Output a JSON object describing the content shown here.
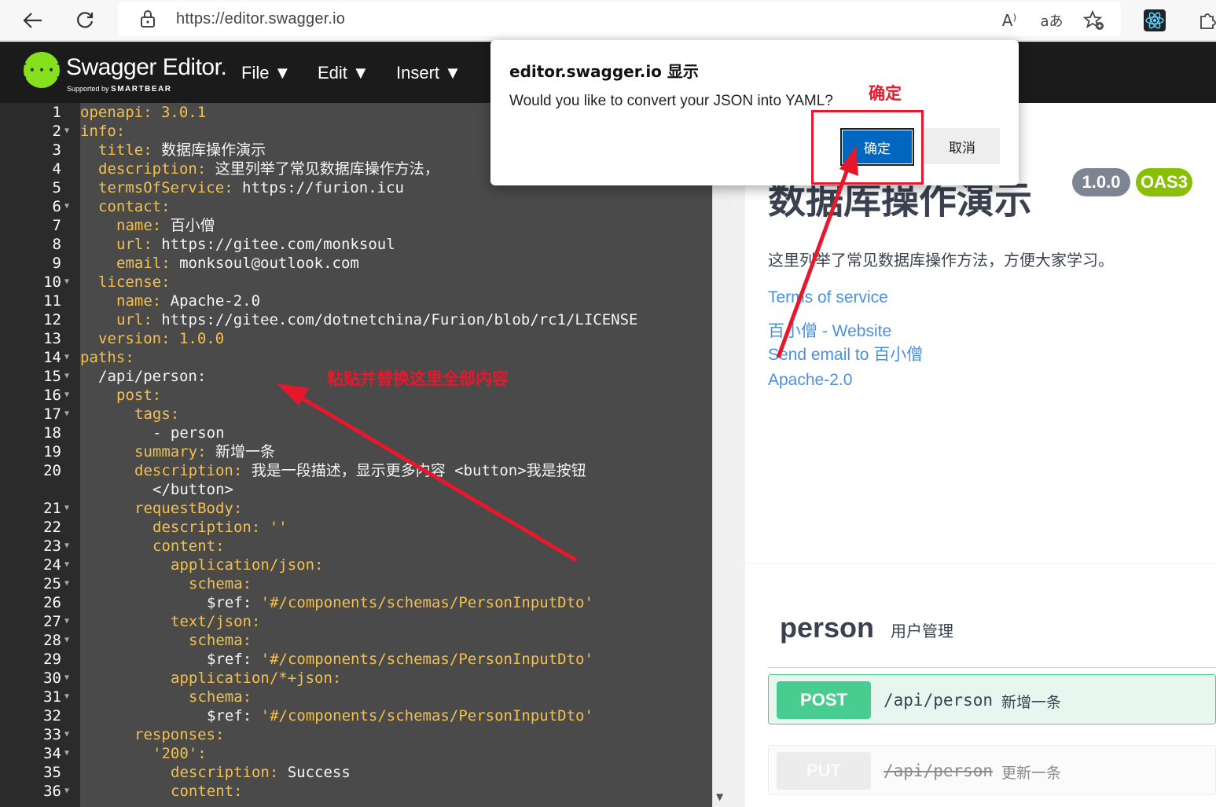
{
  "browser": {
    "url": "https://editor.swagger.io",
    "icons": [
      "back-arrow-icon",
      "refresh-icon",
      "lock-icon",
      "read-aloud-icon",
      "translate-icon",
      "favorite-add-icon",
      "react-devtools-icon",
      "extensions-icon"
    ],
    "read_aloud_glyph": "A⁾",
    "translate_glyph": "aあ"
  },
  "swagger": {
    "logo_glyph": "{···}",
    "title": "Swagger Editor.",
    "supported_prefix": "Supported by ",
    "supported_brand": "SMARTBEAR",
    "menu": [
      "File ▼",
      "Edit ▼",
      "Insert ▼"
    ]
  },
  "editor": {
    "lines": [
      {
        "n": "1",
        "fold": false,
        "indent": 0,
        "key": "openapi",
        "sep": ": ",
        "val": "3.0.1",
        "valtype": "s"
      },
      {
        "n": "2",
        "fold": true,
        "indent": 0,
        "key": "info",
        "sep": ":",
        "val": "",
        "valtype": "t"
      },
      {
        "n": "3",
        "fold": false,
        "indent": 1,
        "key": "title",
        "sep": ": ",
        "val": "数据库操作演示",
        "valtype": "t"
      },
      {
        "n": "4",
        "fold": false,
        "indent": 1,
        "key": "description",
        "sep": ": ",
        "val": "这里列举了常见数据库操作方法，",
        "valtype": "t"
      },
      {
        "n": "5",
        "fold": false,
        "indent": 1,
        "key": "termsOfService",
        "sep": ": ",
        "val": "https://furion.icu",
        "valtype": "t"
      },
      {
        "n": "6",
        "fold": true,
        "indent": 1,
        "key": "contact",
        "sep": ":",
        "val": "",
        "valtype": "t"
      },
      {
        "n": "7",
        "fold": false,
        "indent": 2,
        "key": "name",
        "sep": ": ",
        "val": "百小僧",
        "valtype": "t"
      },
      {
        "n": "8",
        "fold": false,
        "indent": 2,
        "key": "url",
        "sep": ": ",
        "val": "https://gitee.com/monksoul",
        "valtype": "t"
      },
      {
        "n": "9",
        "fold": false,
        "indent": 2,
        "key": "email",
        "sep": ": ",
        "val": "monksoul@outlook.com",
        "valtype": "t"
      },
      {
        "n": "10",
        "fold": true,
        "indent": 1,
        "key": "license",
        "sep": ":",
        "val": "",
        "valtype": "t"
      },
      {
        "n": "11",
        "fold": false,
        "indent": 2,
        "key": "name",
        "sep": ": ",
        "val": "Apache-2.0",
        "valtype": "t"
      },
      {
        "n": "12",
        "fold": false,
        "indent": 2,
        "key": "url",
        "sep": ": ",
        "val": "https://gitee.com/dotnetchina/Furion/blob/rc1/LICENSE",
        "valtype": "t"
      },
      {
        "n": "13",
        "fold": false,
        "indent": 1,
        "key": "version",
        "sep": ": ",
        "val": "1.0.0",
        "valtype": "s"
      },
      {
        "n": "14",
        "fold": true,
        "indent": 0,
        "key": "paths",
        "sep": ":",
        "val": "",
        "valtype": "t"
      },
      {
        "n": "15",
        "fold": true,
        "indent": 1,
        "key": "",
        "sep": "",
        "val": "/api/person:",
        "valtype": "t"
      },
      {
        "n": "16",
        "fold": true,
        "indent": 2,
        "key": "post",
        "sep": ":",
        "val": "",
        "valtype": "t"
      },
      {
        "n": "17",
        "fold": true,
        "indent": 3,
        "key": "tags",
        "sep": ":",
        "val": "",
        "valtype": "t"
      },
      {
        "n": "18",
        "fold": false,
        "indent": 4,
        "key": "",
        "sep": "",
        "val": "- person",
        "valtype": "t"
      },
      {
        "n": "19",
        "fold": false,
        "indent": 3,
        "key": "summary",
        "sep": ": ",
        "val": "新增一条",
        "valtype": "t"
      },
      {
        "n": "20",
        "fold": false,
        "indent": 3,
        "key": "description",
        "sep": ": ",
        "val": "我是一段描述，显示更多内容 <button>我是按钮",
        "valtype": "t"
      },
      {
        "n": "",
        "fold": false,
        "indent": 4,
        "key": "",
        "sep": "",
        "val": "</button>",
        "valtype": "t"
      },
      {
        "n": "21",
        "fold": true,
        "indent": 3,
        "key": "requestBody",
        "sep": ":",
        "val": "",
        "valtype": "t"
      },
      {
        "n": "22",
        "fold": false,
        "indent": 4,
        "key": "description",
        "sep": ": ",
        "val": "''",
        "valtype": "s"
      },
      {
        "n": "23",
        "fold": true,
        "indent": 4,
        "key": "content",
        "sep": ":",
        "val": "",
        "valtype": "t"
      },
      {
        "n": "24",
        "fold": true,
        "indent": 5,
        "key": "application/json",
        "sep": ":",
        "val": "",
        "valtype": "t"
      },
      {
        "n": "25",
        "fold": true,
        "indent": 6,
        "key": "schema",
        "sep": ":",
        "val": "",
        "valtype": "t"
      },
      {
        "n": "26",
        "fold": false,
        "indent": 7,
        "key": "$ref",
        "sep": ": ",
        "val": "'#/components/schemas/PersonInputDto'",
        "valtype": "s",
        "keytype": "t"
      },
      {
        "n": "27",
        "fold": true,
        "indent": 5,
        "key": "text/json",
        "sep": ":",
        "val": "",
        "valtype": "t"
      },
      {
        "n": "28",
        "fold": true,
        "indent": 6,
        "key": "schema",
        "sep": ":",
        "val": "",
        "valtype": "t"
      },
      {
        "n": "29",
        "fold": false,
        "indent": 7,
        "key": "$ref",
        "sep": ": ",
        "val": "'#/components/schemas/PersonInputDto'",
        "valtype": "s",
        "keytype": "t"
      },
      {
        "n": "30",
        "fold": true,
        "indent": 5,
        "key": "application/*+json",
        "sep": ":",
        "val": "",
        "valtype": "t"
      },
      {
        "n": "31",
        "fold": true,
        "indent": 6,
        "key": "schema",
        "sep": ":",
        "val": "",
        "valtype": "t"
      },
      {
        "n": "32",
        "fold": false,
        "indent": 7,
        "key": "$ref",
        "sep": ": ",
        "val": "'#/components/schemas/PersonInputDto'",
        "valtype": "s",
        "keytype": "t"
      },
      {
        "n": "33",
        "fold": true,
        "indent": 3,
        "key": "responses",
        "sep": ":",
        "val": "",
        "valtype": "t"
      },
      {
        "n": "34",
        "fold": true,
        "indent": 4,
        "key": "'200'",
        "sep": ":",
        "val": "",
        "valtype": "t",
        "keytype": "s"
      },
      {
        "n": "35",
        "fold": false,
        "indent": 5,
        "key": "description",
        "sep": ": ",
        "val": "Success",
        "valtype": "t"
      },
      {
        "n": "36",
        "fold": true,
        "indent": 5,
        "key": "content",
        "sep": ":",
        "val": "",
        "valtype": "t"
      }
    ]
  },
  "preview": {
    "title": "数据库操作演示",
    "version_badge": "1.0.0",
    "oas_badge": "OAS3",
    "description": "这里列举了常见数据库操作方法，方便大家学习。",
    "terms_link": "Terms of service",
    "website_link": "百小僧 - Website",
    "email_link": "Send email to 百小僧",
    "license_link": "Apache-2.0",
    "tag_name": "person",
    "tag_description": "用户管理",
    "operations": [
      {
        "method": "POST",
        "path": "/api/person",
        "summary": "新增一条",
        "deprecated": false
      },
      {
        "method": "PUT",
        "path": "/api/person",
        "summary": "更新一条",
        "deprecated": true
      }
    ]
  },
  "dialog": {
    "title": "editor.swagger.io 显示",
    "message": "Would you like to convert your JSON into YAML?",
    "ok_label": "确定",
    "cancel_label": "取消"
  },
  "annotations": {
    "confirm_label": "确定",
    "paste_label": "粘贴并替换这里全部内容",
    "color": "#e8182c"
  },
  "colors": {
    "topbar": "#1b1b1b",
    "editor_bg": "#4a4a4a",
    "yaml_key": "#f3c04d",
    "post_green": "#49cc90",
    "link_blue": "#4990e2",
    "dialog_ok": "#0067c0"
  }
}
